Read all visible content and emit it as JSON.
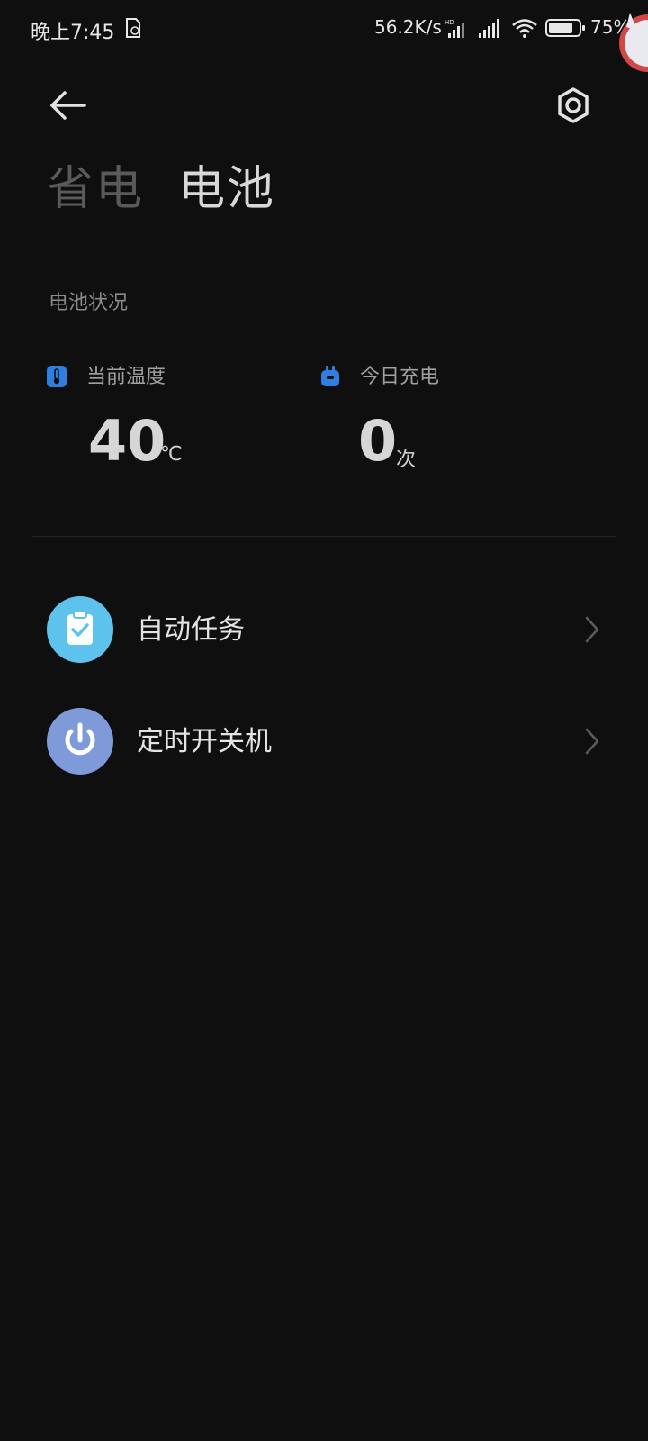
{
  "status_bar": {
    "time": "晚上7:45",
    "network_speed": "56.2K/s",
    "battery_percent": "75%"
  },
  "header": {
    "tabs": [
      {
        "label": "省电",
        "active": false
      },
      {
        "label": "电池",
        "active": true
      }
    ]
  },
  "battery_status": {
    "heading": "电池状况",
    "temperature": {
      "label": "当前温度",
      "value": "40",
      "unit": "℃"
    },
    "charge_today": {
      "label": "今日充电",
      "value": "0",
      "unit": "次"
    }
  },
  "menu": {
    "items": [
      {
        "label": "自动任务",
        "icon": "clipboard-check-icon"
      },
      {
        "label": "定时开关机",
        "icon": "power-icon"
      }
    ]
  },
  "colors": {
    "background": "#0f0f0f",
    "auto_task_icon_bg": "#5ec3ec",
    "power_icon_bg": "#7e9ad8",
    "stat_icon_blue": "#2f7fe0"
  }
}
